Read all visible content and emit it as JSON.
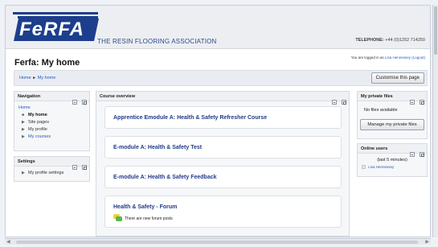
{
  "header": {
    "logo_text": "FeRFA",
    "tagline": "THE RESIN FLOORING ASSOCIATION",
    "phone_label": "TELEPHONE:",
    "phone_number": "+44 (0)1252 714250"
  },
  "page": {
    "title": "Ferfa: My home",
    "login_prefix": "You are logged in as",
    "login_user": "Lisa Hennessey",
    "logout": "(Logout)"
  },
  "breadcrumb": [
    "Home",
    "►",
    "My home"
  ],
  "customise_button": "Customise this page",
  "navigation": {
    "title": "Navigation",
    "home": "Home",
    "items": [
      {
        "label": "My home"
      },
      {
        "label": "Site pages"
      },
      {
        "label": "My profile"
      },
      {
        "label": "My courses"
      }
    ]
  },
  "settings": {
    "title": "Settings",
    "items": [
      {
        "label": "My profile settings"
      }
    ]
  },
  "course_overview": {
    "title": "Course overview",
    "courses": [
      {
        "title": "Apprentice Emodule A: Health & Safety Refresher Course"
      },
      {
        "title": "E-module A: Health & Safety Test"
      },
      {
        "title": "E-module A: Health & Safety Feedback"
      },
      {
        "title": "Health & Safety - Forum",
        "note": "There are new forum posts"
      }
    ]
  },
  "private_files": {
    "title": "My private files",
    "empty": "No files available",
    "manage_button": "Manage my private files"
  },
  "online_users": {
    "title": "Online users",
    "window": "(last 5 minutes)",
    "users": [
      "Lisa Hennessey"
    ]
  },
  "colors": {
    "brand_blue": "#1d3e8c",
    "link": "#2a58b8"
  }
}
